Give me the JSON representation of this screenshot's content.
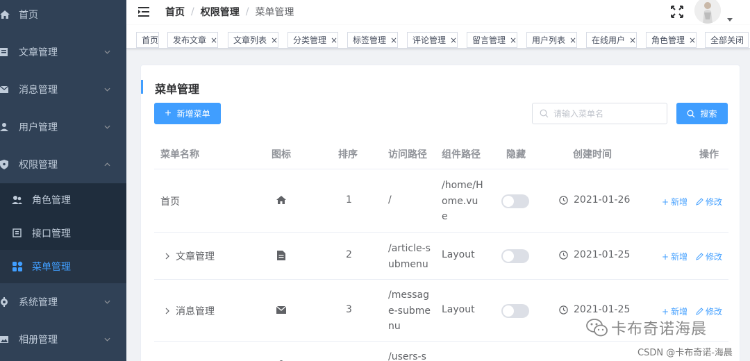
{
  "sidebar": {
    "items": [
      {
        "label": "首页",
        "icon": "home-icon",
        "expandable": false
      },
      {
        "label": "文章管理",
        "icon": "document-icon",
        "expandable": true
      },
      {
        "label": "消息管理",
        "icon": "mail-icon",
        "expandable": true
      },
      {
        "label": "用户管理",
        "icon": "user-icon",
        "expandable": true
      },
      {
        "label": "权限管理",
        "icon": "shield-icon",
        "expandable": true,
        "expanded": true
      },
      {
        "label": "系统管理",
        "icon": "gear-icon",
        "expandable": true
      },
      {
        "label": "相册管理",
        "icon": "picture-icon",
        "expandable": true
      }
    ],
    "submenu": [
      {
        "label": "角色管理",
        "icon": "users-icon"
      },
      {
        "label": "接口管理",
        "icon": "api-icon"
      },
      {
        "label": "菜单管理",
        "icon": "menu-grid-icon",
        "active": true
      }
    ]
  },
  "header": {
    "breadcrumb": [
      "首页",
      "权限管理",
      "菜单管理"
    ]
  },
  "tags": {
    "items": [
      "首页",
      "发布文章",
      "文章列表",
      "分类管理",
      "标签管理",
      "评论管理",
      "留言管理",
      "用户列表",
      "在线用户",
      "角色管理"
    ],
    "close_all": "全部关闭",
    "close_symbol": "×"
  },
  "main": {
    "title": "菜单管理",
    "add_button": "新增菜单",
    "search_placeholder": "请输入菜单名",
    "search_button": "搜索"
  },
  "table": {
    "columns": [
      "菜单名称",
      "图标",
      "排序",
      "访问路径",
      "组件路径",
      "隐藏",
      "创建时间",
      "操作"
    ],
    "rows": [
      {
        "name": "首页",
        "icon": "home-icon",
        "order": "1",
        "path": "/",
        "component": "/home/Home.vue",
        "hidden": false,
        "created": "2021-01-26",
        "expandable": false
      },
      {
        "name": "文章管理",
        "icon": "document-icon",
        "order": "2",
        "path": "/article-submenu",
        "component": "Layout",
        "hidden": false,
        "created": "2021-01-25",
        "expandable": true
      },
      {
        "name": "消息管理",
        "icon": "mail-icon",
        "order": "3",
        "path": "/message-submenu",
        "component": "Layout",
        "hidden": false,
        "created": "2021-01-25",
        "expandable": true
      },
      {
        "name": "",
        "icon": "user-icon",
        "order": "",
        "path": "/users-s",
        "component": "",
        "hidden": false,
        "created": "",
        "expandable": false
      }
    ],
    "ops": {
      "add": "新增",
      "edit": "修改"
    }
  },
  "watermark": {
    "brand": "卡布奇诺海晨",
    "csdn": "CSDN @卡布奇诺-海晨"
  },
  "colors": {
    "sidebar_bg": "#304156",
    "submenu_bg": "#1f2d3d",
    "accent": "#409eff"
  }
}
